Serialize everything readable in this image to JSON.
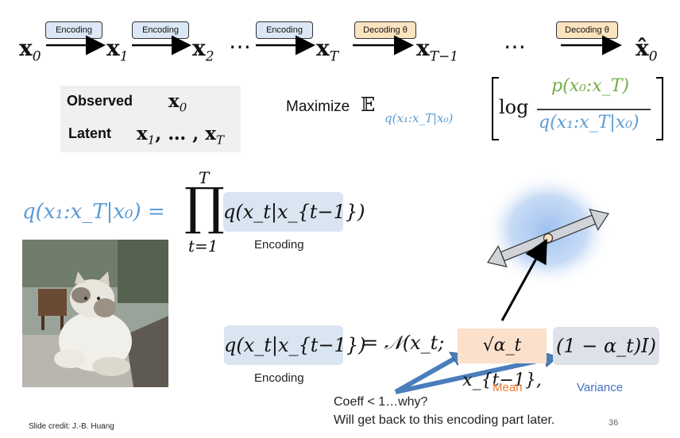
{
  "chain": {
    "nodes": [
      {
        "base": "x",
        "sub": "0"
      },
      {
        "base": "x",
        "sub": "1"
      },
      {
        "base": "x",
        "sub": "2"
      },
      {
        "base": "x",
        "sub": "T"
      },
      {
        "base": "x",
        "sub": "T−1"
      },
      {
        "base": "x̂",
        "sub": "0"
      }
    ],
    "ellipsis": "⋯",
    "encoding_label": "Encoding",
    "decoding_label": "Decoding θ"
  },
  "variables": {
    "observed_label": "Observed",
    "observed_value": "x",
    "observed_sub": "0",
    "latent_label": "Latent",
    "latent_value": "x",
    "latent_sub1": "1",
    "latent_mid": ", … , x",
    "latent_sub2": "T"
  },
  "objective": {
    "maximize_label": "Maximize",
    "expectation": "𝔼",
    "sub_dist": "q(x₁:x_T|x₀)",
    "log": "log",
    "numerator": "p(x₀:x_T)",
    "denominator": "q(x₁:x_T|x₀)"
  },
  "product_eq": {
    "lhs": "q(x₁:x_T|x₀) =",
    "prod_symbol": "∏",
    "upper": "T",
    "lower": "t=1",
    "term": "q(x_t|x_{t−1})",
    "caption": "Encoding"
  },
  "normal_eq": {
    "lhs": "q(x_t|x_{t−1})",
    "equals": "= 𝒩(x_t;",
    "mean": "√α_t x_{t−1},",
    "variance": "(1 − α_t)I)",
    "caption": "Encoding",
    "mean_label": "Mean",
    "variance_label": "Variance"
  },
  "notes": {
    "coeff_note": "Coeff < 1…why?",
    "later_note": "Will get back to this encoding part later.",
    "page_number": "36",
    "credit": "Slide credit: J.-B. Huang"
  },
  "image": {
    "alt": "cat-photo"
  },
  "colors": {
    "blue": "#5b9bd5",
    "green": "#70ad47",
    "mean_color": "#ed7d31",
    "variance_color": "#4472c4",
    "encoding_tag": "#dbe7f4",
    "decoding_tag": "#fbe3bf"
  }
}
